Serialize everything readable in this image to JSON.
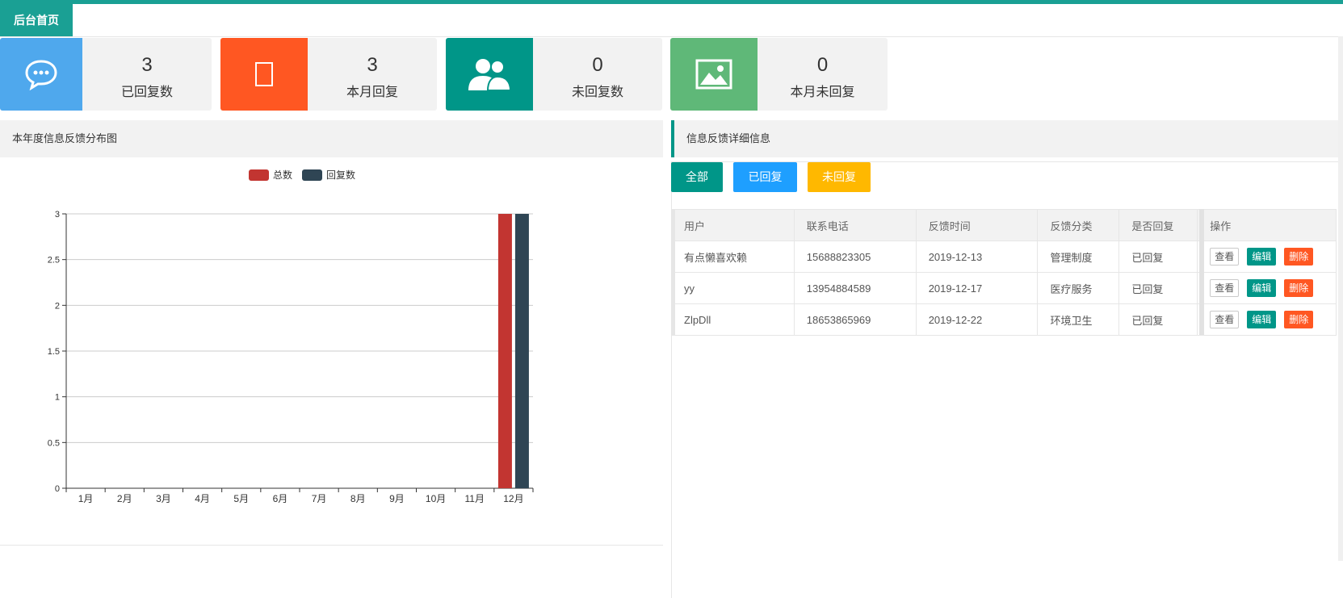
{
  "tabs": {
    "home": "后台首页"
  },
  "stats": [
    {
      "value": "3",
      "label": "已回复数",
      "color": "#4fa8ed",
      "icon": "chat-bubble-icon"
    },
    {
      "value": "3",
      "label": "本月回复",
      "color": "#ff5722",
      "icon": "missing-glyph-icon"
    },
    {
      "value": "0",
      "label": "未回复数",
      "color": "#009688",
      "icon": "users-icon"
    },
    {
      "value": "0",
      "label": "本月未回复",
      "color": "#5fb878",
      "icon": "image-icon"
    }
  ],
  "left_panel": {
    "title": "本年度信息反馈分布图"
  },
  "right_panel": {
    "title": "信息反馈详细信息"
  },
  "filters": {
    "all": "全部",
    "replied": "已回复",
    "unreplied": "未回复"
  },
  "table": {
    "headers": [
      "用户",
      "联系电话",
      "反馈时间",
      "反馈分类",
      "是否回复",
      "操作"
    ],
    "rows": [
      [
        "有点懒喜欢赖",
        "15688823305",
        "2019-12-13",
        "管理制度",
        "已回复"
      ],
      [
        "yy",
        "13954884589",
        "2019-12-17",
        "医疗服务",
        "已回复"
      ],
      [
        "ZlpDll",
        "18653865969",
        "2019-12-22",
        "环境卫生",
        "已回复"
      ]
    ],
    "actions": {
      "view": "查看",
      "edit": "编辑",
      "delete": "删除"
    }
  },
  "chart_data": {
    "type": "bar",
    "categories": [
      "1月",
      "2月",
      "3月",
      "4月",
      "5月",
      "6月",
      "7月",
      "8月",
      "9月",
      "10月",
      "11月",
      "12月"
    ],
    "series": [
      {
        "name": "总数",
        "color": "#c23531",
        "values": [
          0,
          0,
          0,
          0,
          0,
          0,
          0,
          0,
          0,
          0,
          0,
          3
        ]
      },
      {
        "name": "回复数",
        "color": "#2f4554",
        "values": [
          0,
          0,
          0,
          0,
          0,
          0,
          0,
          0,
          0,
          0,
          0,
          3
        ]
      }
    ],
    "ylim": [
      0,
      3
    ],
    "yticks": [
      "0",
      "0.5",
      "1",
      "1.5",
      "2",
      "2.5",
      "3"
    ],
    "grid": true,
    "legend": "top-center"
  }
}
